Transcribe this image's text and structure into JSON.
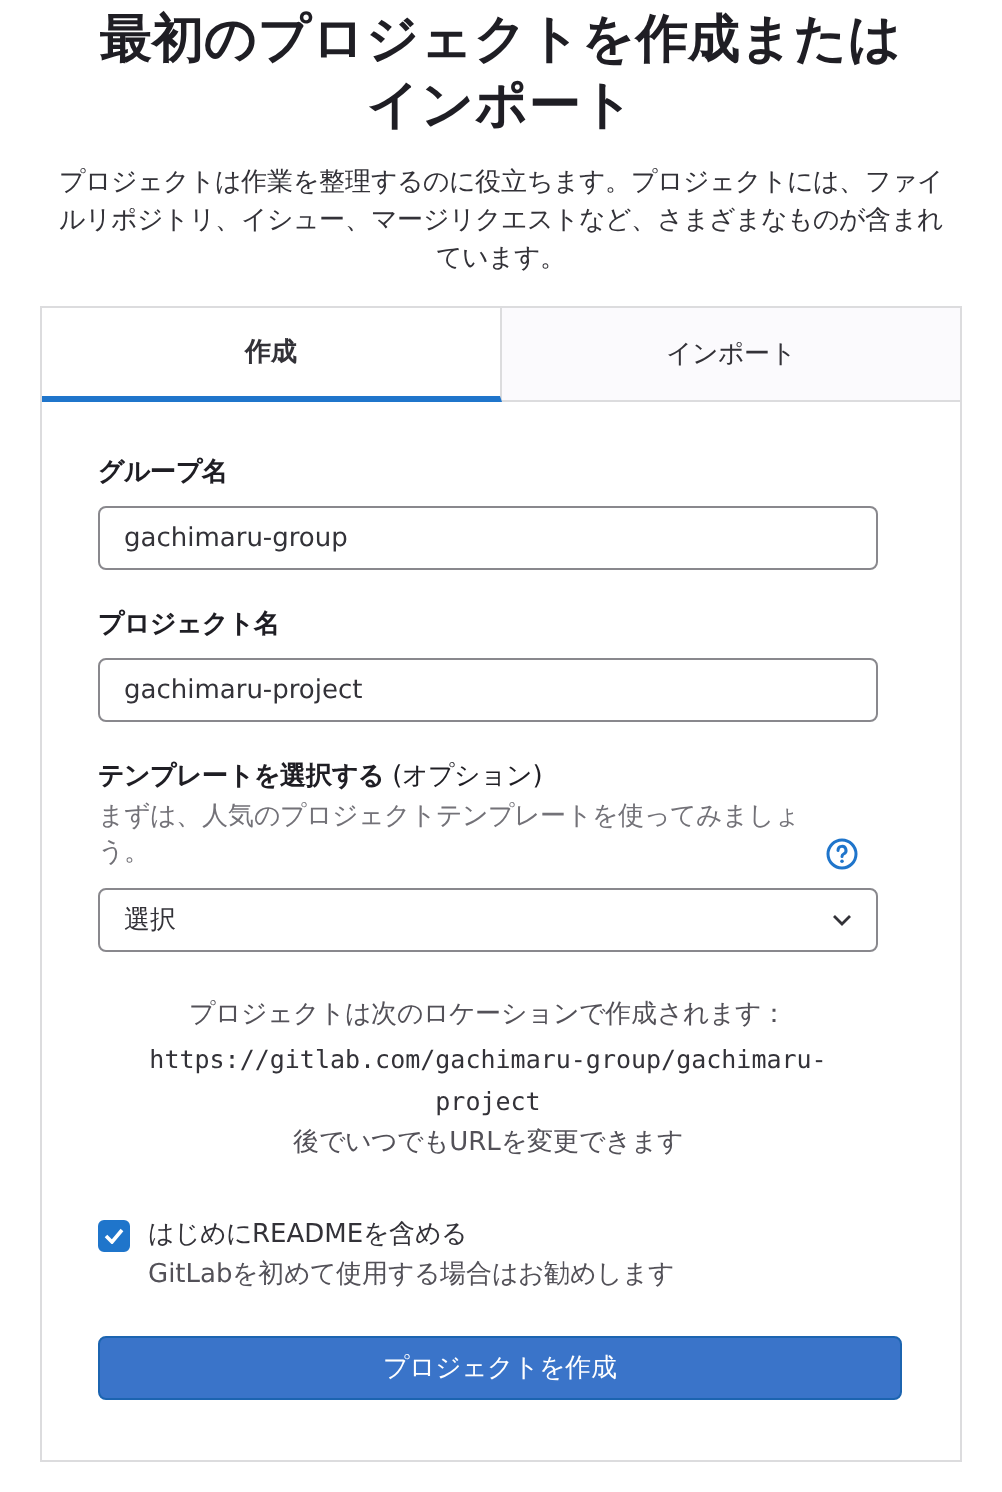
{
  "heading": "最初のプロジェクトを作成またはインポート",
  "description": "プロジェクトは作業を整理するのに役立ちます。プロジェクトには、ファイルリポジトリ、イシュー、マージリクエストなど、さまざまなものが含まれています。",
  "tabs": [
    {
      "label": "作成",
      "selected": true
    },
    {
      "label": "インポート",
      "selected": false
    }
  ],
  "form": {
    "group_name": {
      "label": "グループ名",
      "value": "gachimaru-group"
    },
    "project_name": {
      "label": "プロジェクト名",
      "value": "gachimaru-project"
    },
    "template": {
      "label": "**テンプレートを選択する** (オプション)",
      "help": "まずは、人気のプロジェクトテンプレートを使ってみましょう。",
      "value": "選択"
    },
    "location": {
      "intro": "プロジェクトは次のロケーションで作成されます：",
      "url": "https://gitlab.com/gachimaru-group/gachimaru-project",
      "note": "後でいつでもURLを変更できます"
    },
    "readme": {
      "label": "はじめにREADMEを含める",
      "hint": "GitLabを初めて使用する場合はお勧めします",
      "checked": true
    },
    "submit": "プロジェクトを作成"
  }
}
